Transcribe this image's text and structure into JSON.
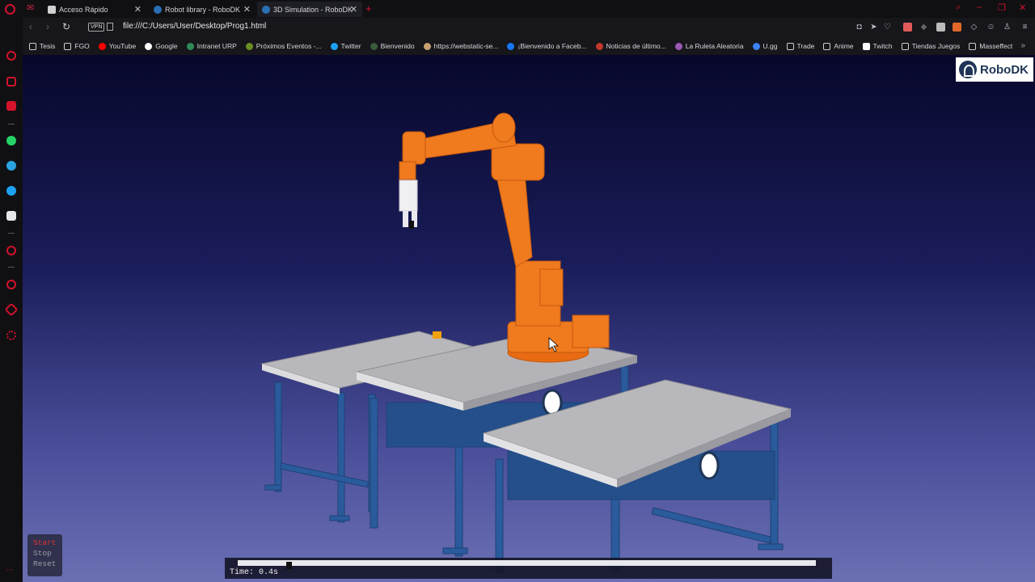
{
  "browser": {
    "tabs": [
      {
        "title": "Acceso Rápido",
        "active": false
      },
      {
        "title": "Robot library - RoboDK",
        "active": false
      },
      {
        "title": "3D Simulation - RoboDK",
        "active": true
      }
    ],
    "close_glyph": "✕",
    "new_tab_glyph": "+",
    "url": "file:///C:/Users/User/Desktop/Prog1.html",
    "vpn_label": "VPN"
  },
  "bookmarks": [
    {
      "label": "Tesis",
      "icon": "folder-icon",
      "color": "#cfcfcf"
    },
    {
      "label": "FGO",
      "icon": "folder-icon",
      "color": "#cfcfcf"
    },
    {
      "label": "YouTube",
      "icon": "youtube-icon",
      "color": "#ff0000"
    },
    {
      "label": "Google",
      "icon": "google-icon",
      "color": "#ffffff"
    },
    {
      "label": "Intranet URP",
      "icon": "site-icon",
      "color": "#2e8b57"
    },
    {
      "label": "Próximos Eventos -...",
      "icon": "site-icon",
      "color": "#6b8e23"
    },
    {
      "label": "Twitter",
      "icon": "twitter-icon",
      "color": "#1da1f2"
    },
    {
      "label": "Bienvenido",
      "icon": "site-icon",
      "color": "#3c5a3c"
    },
    {
      "label": "https://webstatic-se...",
      "icon": "site-icon",
      "color": "#c8a070"
    },
    {
      "label": "¡Bienvenido a Faceb...",
      "icon": "facebook-icon",
      "color": "#1877f2"
    },
    {
      "label": "Noticias de último...",
      "icon": "site-icon",
      "color": "#c0392b"
    },
    {
      "label": "La Ruleta Aleatoria",
      "icon": "site-icon",
      "color": "#9b59b6"
    },
    {
      "label": "U.gg",
      "icon": "site-icon",
      "color": "#3b82f6"
    },
    {
      "label": "Trade",
      "icon": "folder-icon",
      "color": "#cfcfcf"
    },
    {
      "label": "Anime",
      "icon": "folder-icon",
      "color": "#cfcfcf"
    },
    {
      "label": "Twitch",
      "icon": "file-icon",
      "color": "#ffffff"
    },
    {
      "label": "Tiendas Juegos",
      "icon": "folder-icon",
      "color": "#cfcfcf"
    },
    {
      "label": "Masseffect",
      "icon": "folder-icon",
      "color": "#cfcfcf"
    }
  ],
  "logo": {
    "text": "RoboDK"
  },
  "controls": {
    "start": "Start",
    "stop": "Stop",
    "reset": "Reset"
  },
  "timeline": {
    "label": "Time: 0.4s",
    "progress": 0.07
  },
  "colors": {
    "accent": "#d3122c",
    "robot": "#f07a1e",
    "table_top": "#b8b8bc",
    "table_frame": "#2a5b9c",
    "start_active": "#e53030",
    "inactive": "#9a9aa8"
  }
}
